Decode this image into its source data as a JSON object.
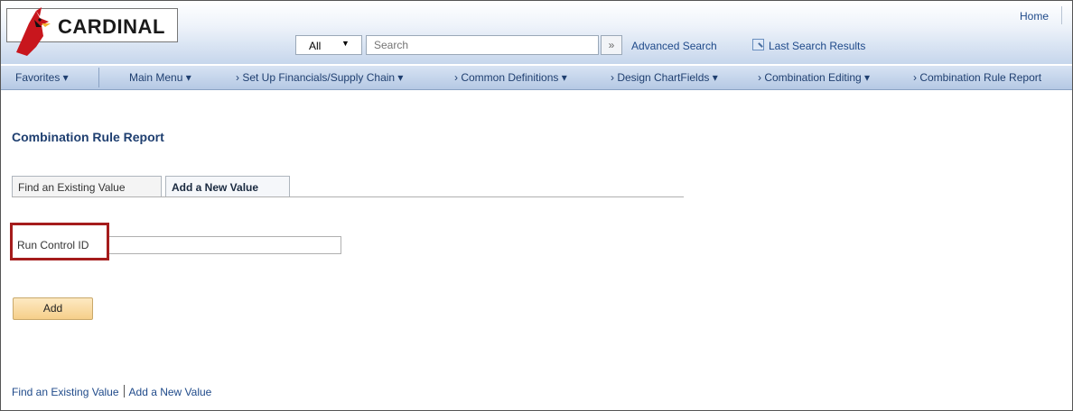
{
  "header": {
    "logo_text": "CARDINAL",
    "home_label": "Home"
  },
  "search": {
    "scope": "All",
    "placeholder": "Search",
    "go_label": "»",
    "advanced_label": "Advanced Search",
    "last_results_label": "Last Search Results"
  },
  "nav": {
    "favorites": "Favorites ▾",
    "main_menu": "Main Menu ▾",
    "crumbs": [
      "›  Set Up Financials/Supply Chain ▾",
      "›  Common Definitions ▾",
      "›  Design ChartFields ▾",
      "›  Combination Editing ▾",
      "›  Combination Rule Report"
    ]
  },
  "page": {
    "title": "Combination Rule Report",
    "tabs": [
      "Find an Existing Value",
      "Add a New Value"
    ],
    "run_control_label": "Run Control ID",
    "run_control_value": "",
    "add_button": "Add"
  },
  "footer": {
    "links": [
      "Find an Existing Value",
      "Add a New Value"
    ]
  },
  "colors": {
    "accent": "#1f4a8a",
    "highlight": "#a51c1c",
    "button": "#f6cf8a"
  }
}
